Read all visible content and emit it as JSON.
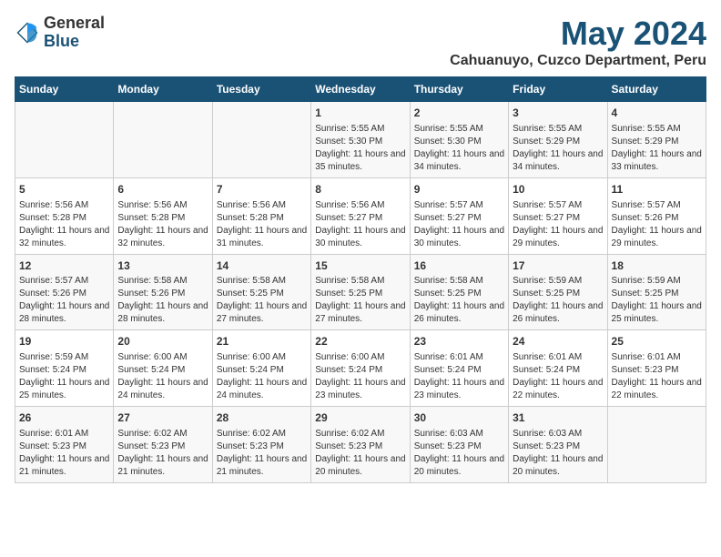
{
  "logo": {
    "general": "General",
    "blue": "Blue"
  },
  "title": "May 2024",
  "subtitle": "Cahuanuyo, Cuzco Department, Peru",
  "days_of_week": [
    "Sunday",
    "Monday",
    "Tuesday",
    "Wednesday",
    "Thursday",
    "Friday",
    "Saturday"
  ],
  "weeks": [
    [
      {
        "num": "",
        "info": ""
      },
      {
        "num": "",
        "info": ""
      },
      {
        "num": "",
        "info": ""
      },
      {
        "num": "1",
        "info": "Sunrise: 5:55 AM\nSunset: 5:30 PM\nDaylight: 11 hours and 35 minutes."
      },
      {
        "num": "2",
        "info": "Sunrise: 5:55 AM\nSunset: 5:30 PM\nDaylight: 11 hours and 34 minutes."
      },
      {
        "num": "3",
        "info": "Sunrise: 5:55 AM\nSunset: 5:29 PM\nDaylight: 11 hours and 34 minutes."
      },
      {
        "num": "4",
        "info": "Sunrise: 5:55 AM\nSunset: 5:29 PM\nDaylight: 11 hours and 33 minutes."
      }
    ],
    [
      {
        "num": "5",
        "info": "Sunrise: 5:56 AM\nSunset: 5:28 PM\nDaylight: 11 hours and 32 minutes."
      },
      {
        "num": "6",
        "info": "Sunrise: 5:56 AM\nSunset: 5:28 PM\nDaylight: 11 hours and 32 minutes."
      },
      {
        "num": "7",
        "info": "Sunrise: 5:56 AM\nSunset: 5:28 PM\nDaylight: 11 hours and 31 minutes."
      },
      {
        "num": "8",
        "info": "Sunrise: 5:56 AM\nSunset: 5:27 PM\nDaylight: 11 hours and 30 minutes."
      },
      {
        "num": "9",
        "info": "Sunrise: 5:57 AM\nSunset: 5:27 PM\nDaylight: 11 hours and 30 minutes."
      },
      {
        "num": "10",
        "info": "Sunrise: 5:57 AM\nSunset: 5:27 PM\nDaylight: 11 hours and 29 minutes."
      },
      {
        "num": "11",
        "info": "Sunrise: 5:57 AM\nSunset: 5:26 PM\nDaylight: 11 hours and 29 minutes."
      }
    ],
    [
      {
        "num": "12",
        "info": "Sunrise: 5:57 AM\nSunset: 5:26 PM\nDaylight: 11 hours and 28 minutes."
      },
      {
        "num": "13",
        "info": "Sunrise: 5:58 AM\nSunset: 5:26 PM\nDaylight: 11 hours and 28 minutes."
      },
      {
        "num": "14",
        "info": "Sunrise: 5:58 AM\nSunset: 5:25 PM\nDaylight: 11 hours and 27 minutes."
      },
      {
        "num": "15",
        "info": "Sunrise: 5:58 AM\nSunset: 5:25 PM\nDaylight: 11 hours and 27 minutes."
      },
      {
        "num": "16",
        "info": "Sunrise: 5:58 AM\nSunset: 5:25 PM\nDaylight: 11 hours and 26 minutes."
      },
      {
        "num": "17",
        "info": "Sunrise: 5:59 AM\nSunset: 5:25 PM\nDaylight: 11 hours and 26 minutes."
      },
      {
        "num": "18",
        "info": "Sunrise: 5:59 AM\nSunset: 5:25 PM\nDaylight: 11 hours and 25 minutes."
      }
    ],
    [
      {
        "num": "19",
        "info": "Sunrise: 5:59 AM\nSunset: 5:24 PM\nDaylight: 11 hours and 25 minutes."
      },
      {
        "num": "20",
        "info": "Sunrise: 6:00 AM\nSunset: 5:24 PM\nDaylight: 11 hours and 24 minutes."
      },
      {
        "num": "21",
        "info": "Sunrise: 6:00 AM\nSunset: 5:24 PM\nDaylight: 11 hours and 24 minutes."
      },
      {
        "num": "22",
        "info": "Sunrise: 6:00 AM\nSunset: 5:24 PM\nDaylight: 11 hours and 23 minutes."
      },
      {
        "num": "23",
        "info": "Sunrise: 6:01 AM\nSunset: 5:24 PM\nDaylight: 11 hours and 23 minutes."
      },
      {
        "num": "24",
        "info": "Sunrise: 6:01 AM\nSunset: 5:24 PM\nDaylight: 11 hours and 22 minutes."
      },
      {
        "num": "25",
        "info": "Sunrise: 6:01 AM\nSunset: 5:23 PM\nDaylight: 11 hours and 22 minutes."
      }
    ],
    [
      {
        "num": "26",
        "info": "Sunrise: 6:01 AM\nSunset: 5:23 PM\nDaylight: 11 hours and 21 minutes."
      },
      {
        "num": "27",
        "info": "Sunrise: 6:02 AM\nSunset: 5:23 PM\nDaylight: 11 hours and 21 minutes."
      },
      {
        "num": "28",
        "info": "Sunrise: 6:02 AM\nSunset: 5:23 PM\nDaylight: 11 hours and 21 minutes."
      },
      {
        "num": "29",
        "info": "Sunrise: 6:02 AM\nSunset: 5:23 PM\nDaylight: 11 hours and 20 minutes."
      },
      {
        "num": "30",
        "info": "Sunrise: 6:03 AM\nSunset: 5:23 PM\nDaylight: 11 hours and 20 minutes."
      },
      {
        "num": "31",
        "info": "Sunrise: 6:03 AM\nSunset: 5:23 PM\nDaylight: 11 hours and 20 minutes."
      },
      {
        "num": "",
        "info": ""
      }
    ]
  ]
}
